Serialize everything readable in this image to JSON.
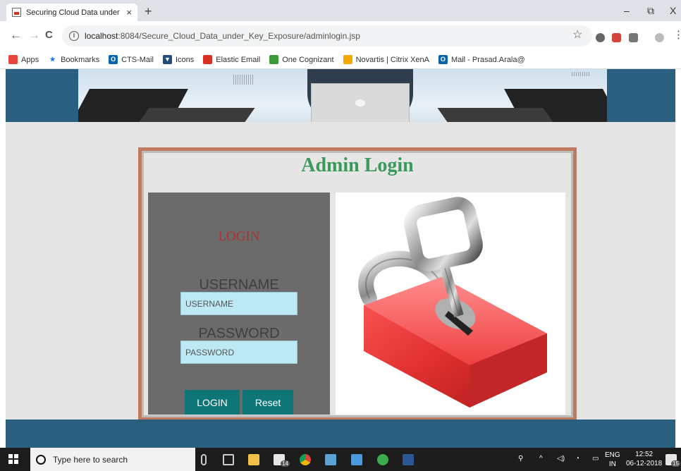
{
  "browser": {
    "tab_title": "Securing Cloud Data under Key E",
    "tab_close": "×",
    "new_tab": "+",
    "url_host": "localhost",
    "url_rest": ":8084/Secure_Cloud_Data_under_Key_Exposure/adminlogin.jsp",
    "window": {
      "minimize": "–",
      "restore": "⧉",
      "close": "X"
    },
    "nav": {
      "back": "←",
      "forward": "→",
      "reload": "C",
      "bookmark_star": "☆",
      "menu": "⋮"
    }
  },
  "bookmarks": [
    {
      "label": "Apps",
      "icon": "apps-grid-icon",
      "color": "#e8453c",
      "glyph": ""
    },
    {
      "label": "Bookmarks",
      "icon": "star-icon",
      "color": "#1a73e8",
      "glyph": "★"
    },
    {
      "label": "CTS-Mail",
      "icon": "outlook-icon",
      "color": "#0a64ad",
      "glyph": "O"
    },
    {
      "label": "Icons",
      "icon": "icons-site-icon",
      "color": "#244d7a",
      "glyph": "▼"
    },
    {
      "label": "Elastic Email",
      "icon": "elastic-email-icon",
      "color": "#d93025",
      "glyph": ""
    },
    {
      "label": "One Cognizant",
      "icon": "cognizant-icon",
      "color": "#3c9a3c",
      "glyph": ""
    },
    {
      "label": "Novartis | Citrix XenA",
      "icon": "citrix-icon",
      "color": "#f2a900",
      "glyph": ""
    },
    {
      "label": "Mail - Prasad.Arala@",
      "icon": "outlook-icon",
      "color": "#0a64ad",
      "glyph": "O"
    }
  ],
  "login": {
    "title": "Admin Login",
    "panel_heading": "LOGIN",
    "username_label": "USERNAME",
    "username_placeholder": "USERNAME",
    "password_label": "PASSWORD",
    "password_placeholder": "PASSWORD",
    "login_button": "LOGIN",
    "reset_button": "Reset"
  },
  "taskbar": {
    "search_placeholder": "Type here to search",
    "lang_top": "ENG",
    "lang_bottom": "IN",
    "time": "12:52",
    "date": "06-12-2018",
    "mail_badge": "14",
    "notification_badge": "15"
  },
  "colors": {
    "title_green": "#3a9a5b",
    "login_red": "#b03030",
    "button_teal": "#0f7677",
    "input_bg": "#bde9f5",
    "frame": "#c07a62",
    "banner_blue": "#2a5f80"
  }
}
